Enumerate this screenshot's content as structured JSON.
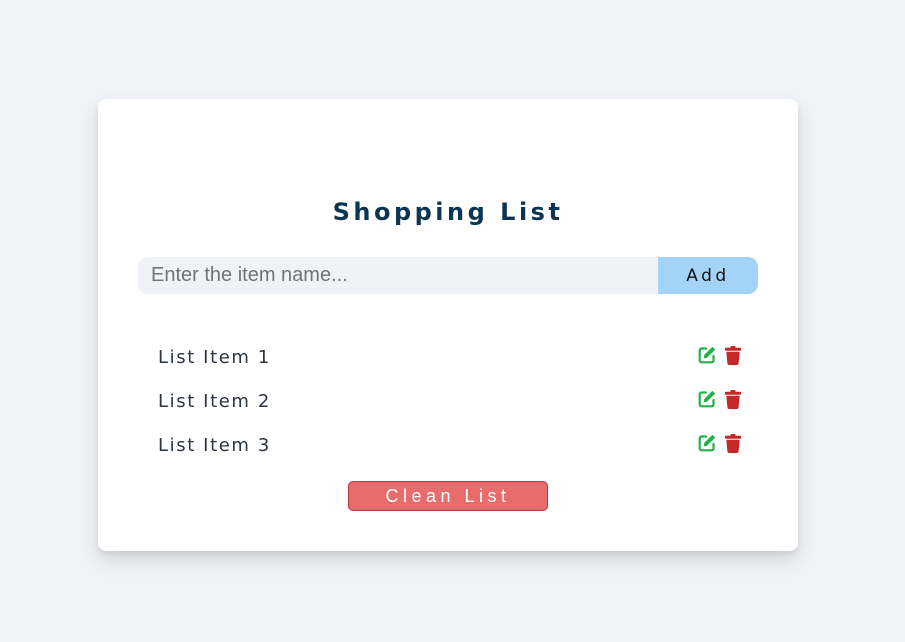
{
  "app": {
    "title": "Shopping List"
  },
  "form": {
    "input_placeholder": "Enter the item name...",
    "input_value": "",
    "add_label": "Add"
  },
  "items": [
    {
      "label": "List Item 1"
    },
    {
      "label": "List Item 2"
    },
    {
      "label": "List Item 3"
    }
  ],
  "actions": {
    "clear_label": "Clean List"
  },
  "icons": {
    "edit": "edit-icon",
    "delete": "trash-icon"
  },
  "colors": {
    "page_background": "#f0f4f8",
    "card_background": "#ffffff",
    "title": "#0b3550",
    "input_background": "#eff3f7",
    "add_button": "#a3d4f7",
    "edit_icon": "#22b14c",
    "delete_icon": "#c62828",
    "clear_button": "#e86c6c",
    "clear_button_border": "#b23a3a"
  }
}
